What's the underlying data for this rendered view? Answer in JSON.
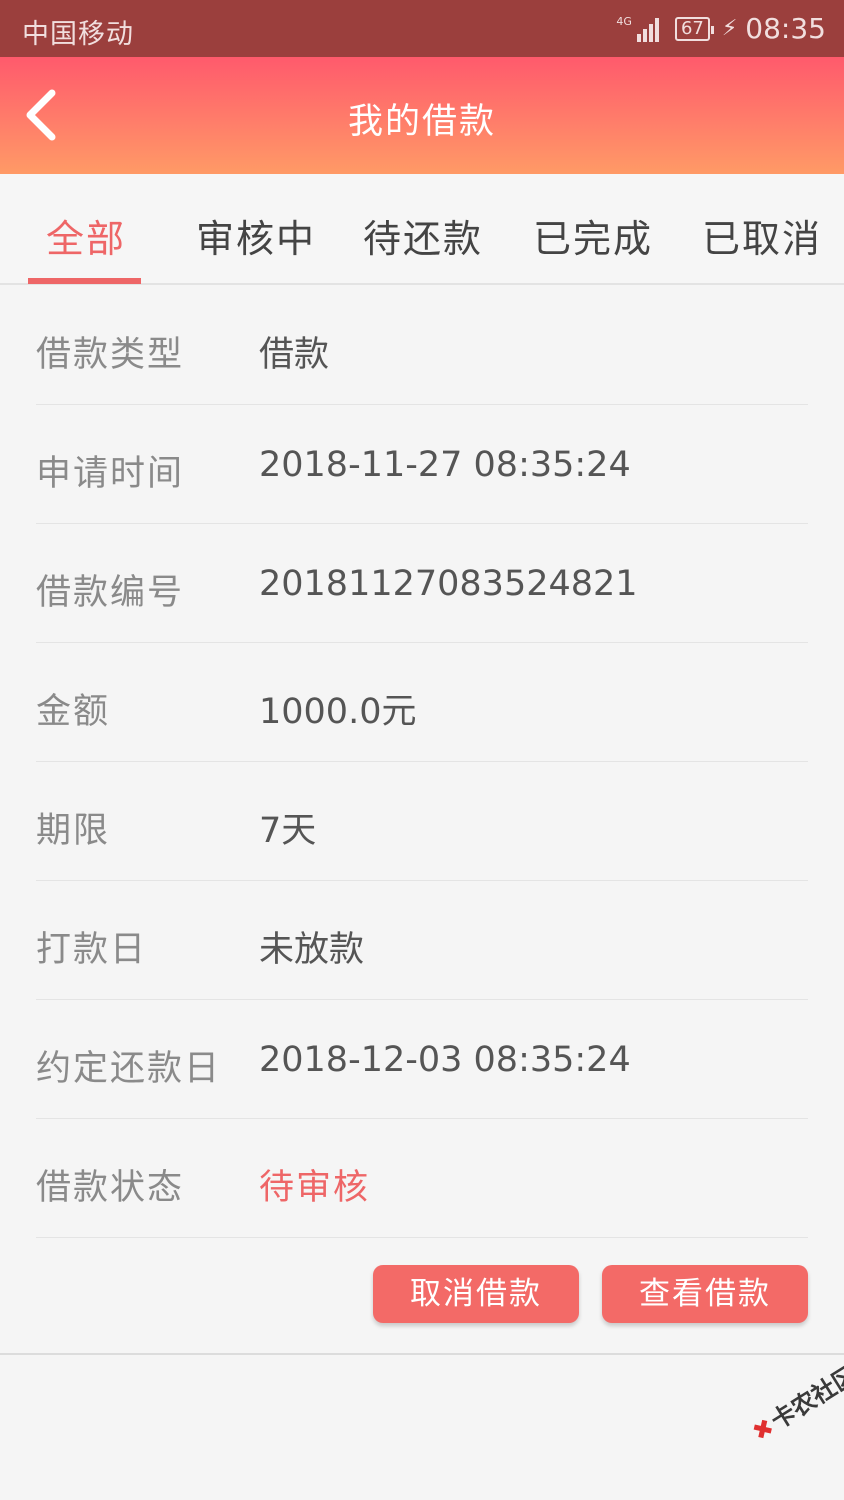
{
  "status_bar": {
    "carrier": "中国移动",
    "network": "4G",
    "battery": "67",
    "time": "08:35"
  },
  "header": {
    "title": "我的借款",
    "back_icon": "chevron-left-icon"
  },
  "tabs": [
    {
      "label": "全部",
      "active": true
    },
    {
      "label": "审核中",
      "active": false
    },
    {
      "label": "待还款",
      "active": false
    },
    {
      "label": "已完成",
      "active": false
    },
    {
      "label": "已取消",
      "active": false
    }
  ],
  "details": [
    {
      "label": "借款类型",
      "value": "借款"
    },
    {
      "label": "申请时间",
      "value": "2018-11-27 08:35:24"
    },
    {
      "label": "借款编号",
      "value": "20181127083524821"
    },
    {
      "label": "金额",
      "value": "1000.0元"
    },
    {
      "label": "期限",
      "value": "7天"
    },
    {
      "label": "打款日",
      "value": "未放款"
    },
    {
      "label": "约定还款日",
      "value": "2018-12-03 08:35:24"
    },
    {
      "label": "借款状态",
      "value": "待审核"
    }
  ],
  "actions": {
    "cancel_label": "取消借款",
    "view_label": "查看借款"
  },
  "watermark": {
    "text": "卡农社区"
  },
  "colors": {
    "accent": "#ee6667",
    "header_top": "#ff5a6c",
    "header_bottom": "#ff9a66",
    "status_bar": "#9b3f3d"
  }
}
